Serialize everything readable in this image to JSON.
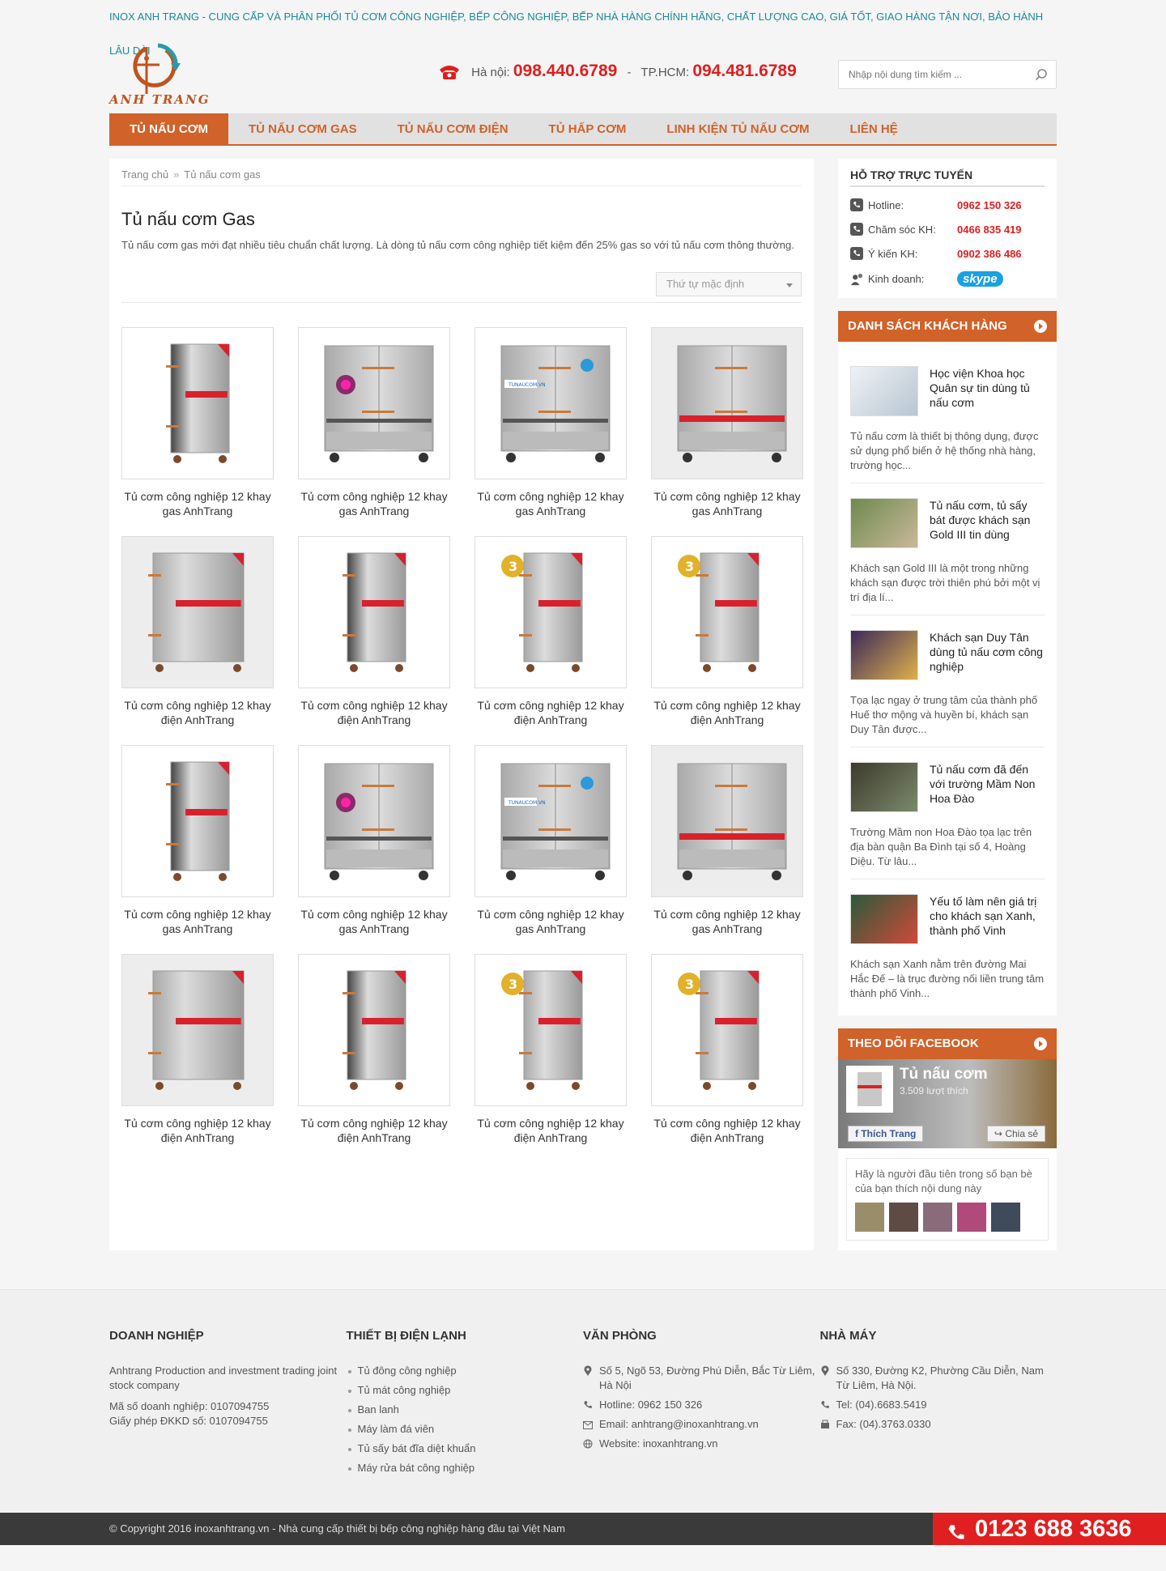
{
  "topline": "INOX ANH TRANG - CUNG CẤP VÀ PHÂN PHỐI TỦ CƠM CÔNG NGHIỆP, BẾP CÔNG NGHIỆP, BẾP NHÀ HÀNG CHÍNH HÃNG, CHẤT LƯỢNG CAO, GIÁ TỐT, GIAO HÀNG TẬN NƠI, BẢO HÀNH LÂU DÀI",
  "header": {
    "logo_text": "ANH TRANG",
    "hanoi_label": "Hà nội:",
    "hanoi_phone": "098.440.6789",
    "separator": "-",
    "hcm_label": "TP.HCM:",
    "hcm_phone": "094.481.6789",
    "search_placeholder": "Nhập nội dung tìm kiếm ..."
  },
  "nav": [
    "TỦ NẤU CƠM",
    "TỦ NẤU CƠM GAS",
    "TỦ NẤU CƠM ĐIỆN",
    "TỦ HẤP CƠM",
    "LINH KIỆN TỦ NẤU CƠM",
    "LIÊN HỆ"
  ],
  "breadcrumb": {
    "home": "Trang chủ",
    "current": "Tủ nấu cơm gas"
  },
  "page": {
    "title": "Tủ nấu cơm Gas",
    "description": "Tủ nấu cơm gas mới đạt nhiều tiêu chuẩn chất lượng. Là dòng tủ nấu cơm công nghiệp tiết kiệm đến 25% gas so với tủ nấu cơm thông thường.",
    "sort_label": "Thứ tự mặc định"
  },
  "products": [
    {
      "line1": "Tủ cơm công nghiệp 12 khay",
      "line2": "gas AnhTrang"
    },
    {
      "line1": "Tủ cơm công nghiệp 12 khay",
      "line2": "gas AnhTrang"
    },
    {
      "line1": "Tủ cơm công nghiệp 12 khay",
      "line2": "gas AnhTrang"
    },
    {
      "line1": "Tủ cơm công nghiệp 12 khay",
      "line2": "gas AnhTrang"
    },
    {
      "line1": "Tủ cơm công nghiệp 12 khay",
      "line2": "điện AnhTrang"
    },
    {
      "line1": "Tủ cơm công nghiệp 12 khay",
      "line2": "điện AnhTrang"
    },
    {
      "line1": "Tủ cơm công nghiệp 12 khay",
      "line2": "điện AnhTrang"
    },
    {
      "line1": "Tủ cơm công nghiệp 12 khay",
      "line2": "điện AnhTrang"
    },
    {
      "line1": "Tủ cơm công nghiệp 12 khay",
      "line2": "gas AnhTrang"
    },
    {
      "line1": "Tủ cơm công nghiệp 12 khay",
      "line2": "gas AnhTrang"
    },
    {
      "line1": "Tủ cơm công nghiệp 12 khay",
      "line2": "gas AnhTrang"
    },
    {
      "line1": "Tủ cơm công nghiệp 12 khay",
      "line2": "gas AnhTrang"
    },
    {
      "line1": "Tủ cơm công nghiệp 12 khay",
      "line2": "điện AnhTrang"
    },
    {
      "line1": "Tủ cơm công nghiệp 12 khay",
      "line2": "điện AnhTrang"
    },
    {
      "line1": "Tủ cơm công nghiệp 12 khay",
      "line2": "điện AnhTrang"
    },
    {
      "line1": "Tủ cơm công nghiệp 12 khay",
      "line2": "điện AnhTrang"
    }
  ],
  "support": {
    "title": "HỖ TRỢ TRỰC TUYẾN",
    "rows": [
      {
        "label": "Hotline:",
        "value": "0962 150 326"
      },
      {
        "label": "Chăm sóc KH:",
        "value": "0466 835 419"
      },
      {
        "label": "Ý kiến KH:",
        "value": "0902 386 486"
      }
    ],
    "sales_label": "Kinh doanh:",
    "skype": "skype"
  },
  "clients": {
    "title": "DANH SÁCH KHÁCH HÀNG",
    "items": [
      {
        "title": "Học viện Khoa học Quân sự tin dùng tủ nấu cơm",
        "desc": "Tủ nấu cơm là thiết bị thông dụng, được sử dụng phổ biến ở hệ thống nhà hàng, trường học..."
      },
      {
        "title": "Tủ nấu cơm, tủ sấy bát được khách sạn Gold III tin dùng",
        "desc": "Khách sạn Gold III là một trong những khách sạn được trời thiên phú bởi một vị trí địa lí..."
      },
      {
        "title": "Khách sạn Duy Tân dùng tủ nấu cơm công nghiệp",
        "desc": "Tọa lạc ngay ở trung tâm của thành phố Huế thơ mộng và huyền bí, khách sạn Duy Tân được..."
      },
      {
        "title": "Tủ nấu cơm đã đến với trường Mầm Non Hoa Đào",
        "desc": "Trường Mầm non Hoa Đào tọa lạc trên địa bàn quận Ba Đình tại số 4, Hoàng Diệu. Từ lâu..."
      },
      {
        "title": "Yếu tố làm nên giá trị cho khách sạn Xanh, thành phố Vinh",
        "desc": "Khách sạn Xanh nằm trên đường Mai Hắc Đế – là trục đường nối liền trung tâm thành phố Vinh..."
      }
    ]
  },
  "facebook": {
    "title": "THEO DÕI FACEBOOK",
    "page_name": "Tủ nấu cơm",
    "likes": "3.509 lượt thích",
    "like_btn": "Thích Trang",
    "share_btn": "Chia sẻ",
    "friends_text": "Hãy là người đầu tiên trong số bạn bè của bạn thích nội dung này"
  },
  "footer": {
    "col1": {
      "title": "DOANH NGHIỆP",
      "company": "Anhtrang Production and investment trading joint stock company",
      "tax": "Mã số doanh nghiệp: 0107094755",
      "license": "Giấy phép ĐKKD số: 0107094755"
    },
    "col2": {
      "title": "THIẾT BỊ ĐIỆN LẠNH",
      "items": [
        "Tủ đông công nghiệp",
        "Tủ mát công nghiệp",
        "Ban lanh",
        "Máy làm đá viên",
        "Tủ sấy bát đĩa diệt khuẩn",
        "Máy rửa bát công nghiệp"
      ]
    },
    "col3": {
      "title": "VĂN PHÒNG",
      "address": "Số 5, Ngõ 53, Đường Phú Diễn, Bắc Từ Liêm, Hà Nội",
      "hotline": "Hotline: 0962 150 326",
      "email": "Email: anhtrang@inoxanhtrang.vn",
      "website": "Website: inoxanhtrang.vn"
    },
    "col4": {
      "title": "NHÀ MÁY",
      "address": "Số 330, Đường K2, Phường Cầu Diễn, Nam Từ Liêm, Hà Nội.",
      "tel": "Tel: (04).6683.5419",
      "fax": "Fax: (04).3763.0330"
    }
  },
  "copyright": "© Copyright 2016 inoxanhtrang.vn - Nhà cung cấp thiết bị bếp công nghiệp hàng đầu tại Việt Nam",
  "hotline_float": "0123 688 3636",
  "colors": {
    "brand_orange": "#d0622a",
    "phone_red": "#e01e1e",
    "topline_teal": "#1a8a9a"
  }
}
